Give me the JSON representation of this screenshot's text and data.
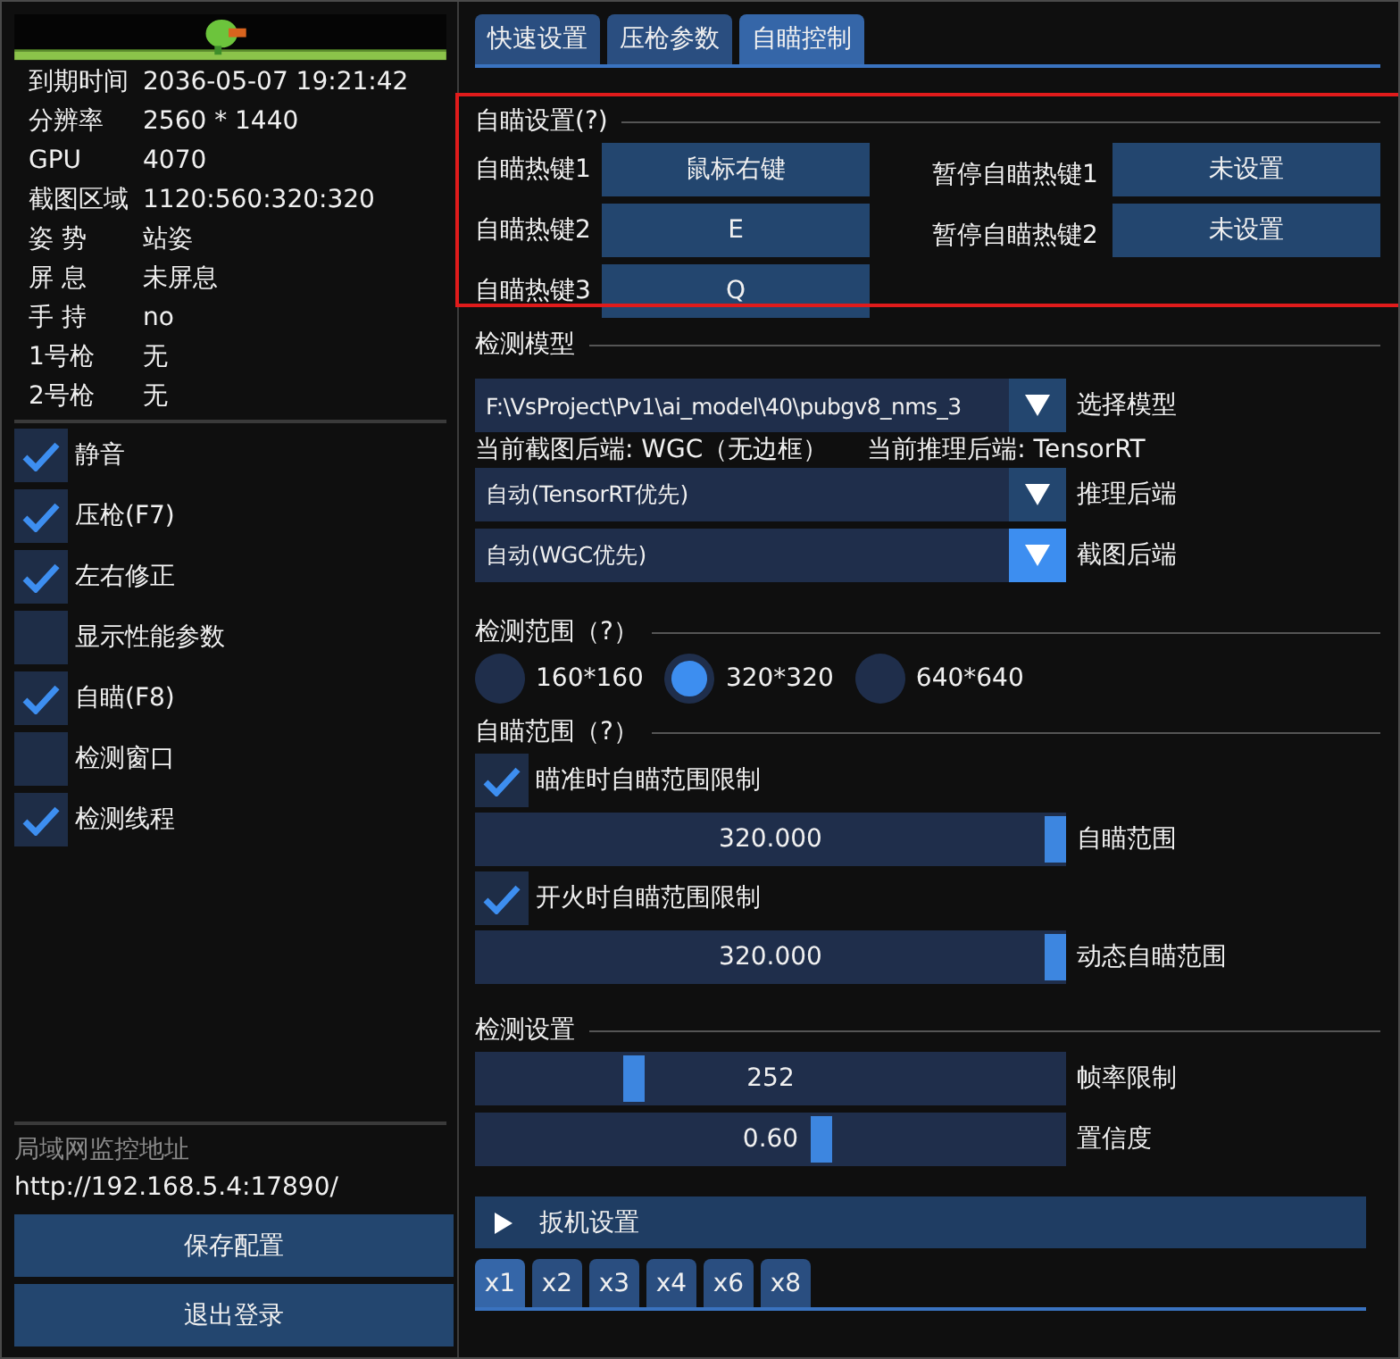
{
  "info": [
    {
      "label": "到期时间",
      "value": "2036-05-07 19:21:42"
    },
    {
      "label": "分辨率",
      "value": "2560 * 1440"
    },
    {
      "label": "GPU",
      "value": "4070"
    },
    {
      "label": "截图区域",
      "value": "1120:560:320:320"
    },
    {
      "label": "姿 势",
      "value": "站姿"
    },
    {
      "label": "屏 息",
      "value": "未屏息"
    },
    {
      "label": "手 持",
      "value": "no"
    },
    {
      "label": "1号枪",
      "value": "无"
    },
    {
      "label": "2号枪",
      "value": "无"
    }
  ],
  "toggles": [
    {
      "label": "静音",
      "checked": true
    },
    {
      "label": "压枪(F7)",
      "checked": true
    },
    {
      "label": "左右修正",
      "checked": true
    },
    {
      "label": "显示性能参数",
      "checked": false
    },
    {
      "label": "自瞄(F8)",
      "checked": true
    },
    {
      "label": "检测窗口",
      "checked": false
    },
    {
      "label": "检测线程",
      "checked": true
    }
  ],
  "lan_monitor": {
    "label": "局域网监控地址",
    "url": "http://192.168.5.4:17890/"
  },
  "buttons": [
    "保存配置",
    "退出登录"
  ],
  "tabs": [
    {
      "label": "快速设置",
      "selected": false
    },
    {
      "label": "压枪参数",
      "selected": false
    },
    {
      "label": "自瞄控制",
      "selected": true
    }
  ],
  "aim_settings": {
    "title": "自瞄设置(?)",
    "highlighted": true,
    "hotkeys": [
      {
        "label": "自瞄热键1",
        "value": "鼠标右键"
      },
      {
        "label": "自瞄热键2",
        "value": "E"
      },
      {
        "label": "自瞄热键3",
        "value": "Q"
      }
    ],
    "pause_hotkeys": [
      {
        "label": "暂停自瞄热键1",
        "value": "未设置"
      },
      {
        "label": "暂停自瞄热键2",
        "value": "未设置"
      }
    ]
  },
  "model": {
    "title": "检测模型",
    "path": "F:\\VsProject\\Pv1\\ai_model\\40\\pubgv8_nms_3",
    "path_label": "选择模型",
    "status": [
      "当前截图后端: WGC（无边框）",
      "当前推理后端: TensorRT"
    ],
    "dropdowns": [
      {
        "value": "自动(TensorRT优先)",
        "label": "推理后端",
        "focused": false
      },
      {
        "value": "自动(WGC优先)",
        "label": "截图后端",
        "focused": true
      }
    ]
  },
  "detect_range": {
    "title": "检测范围（?）",
    "options": [
      {
        "label": "160*160",
        "selected": false
      },
      {
        "label": "320*320",
        "selected": true
      },
      {
        "label": "640*640",
        "selected": false
      }
    ]
  },
  "aim_range": {
    "title": "自瞄范围（?）",
    "items": [
      {
        "kind": "checkbox",
        "label": "瞄准时自瞄范围限制",
        "checked": true
      },
      {
        "kind": "slider",
        "label": "自瞄范围",
        "reading": "320.000",
        "level": 1
      },
      {
        "kind": "checkbox",
        "label": "开火时自瞄范围限制",
        "checked": true
      },
      {
        "kind": "slider",
        "label": "动态自瞄范围",
        "reading": "320.000",
        "level": 1
      }
    ]
  },
  "detect_settings": {
    "title": "检测设置",
    "sliders": [
      {
        "label": "帧率限制",
        "reading": "252",
        "level": 0.26
      },
      {
        "label": "置信度",
        "reading": "0.60",
        "level": 0.59
      }
    ]
  },
  "trigger": {
    "title": "扳机设置",
    "expanded": false
  },
  "multipliers": [
    {
      "label": "x1",
      "selected": true
    },
    {
      "label": "x2",
      "selected": false
    },
    {
      "label": "x3",
      "selected": false
    },
    {
      "label": "x4",
      "selected": false
    },
    {
      "label": "x6",
      "selected": false
    },
    {
      "label": "x8",
      "selected": false
    }
  ]
}
